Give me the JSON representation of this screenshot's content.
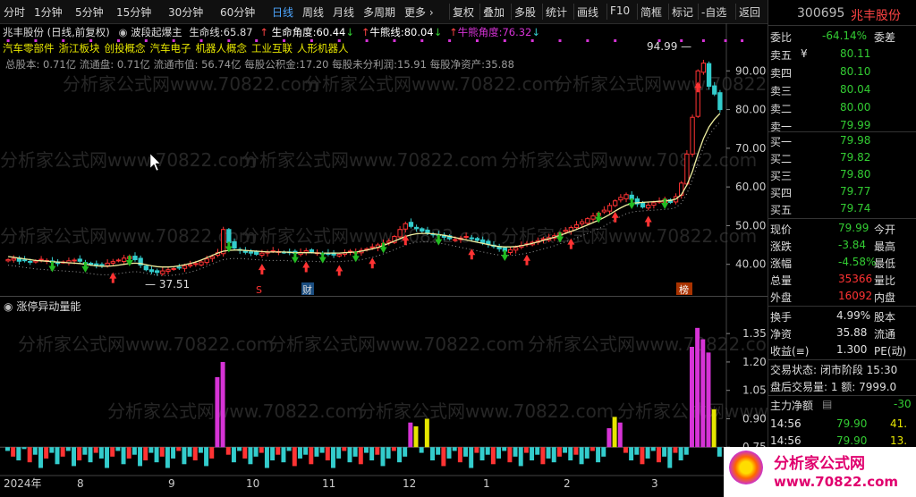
{
  "toolbar": {
    "periods": [
      "分时",
      "1分钟",
      "5分钟",
      "15分钟",
      "30分钟",
      "60分钟",
      "日线",
      "周线",
      "月线",
      "多周期",
      "更多 ›"
    ],
    "active_period": "日线",
    "tools": [
      "复权",
      "叠加",
      "多股",
      "统计",
      "画线",
      "F10",
      "简框",
      "标记",
      "-自选",
      "返回"
    ]
  },
  "info": {
    "title": "兆丰股份 (日线,前复权)",
    "indicator_name": "波段起爆主",
    "life_line_label": "生命线:",
    "life_line_value": "65.87",
    "life_angle_label": "生命角度:",
    "life_angle_value": "60.44",
    "bull_line_label": "牛熊线:",
    "bull_line_value": "80.04",
    "bull_angle_label": "牛熊角度:",
    "bull_angle_value": "76.32",
    "concepts": [
      "汽车零部件",
      "浙江板块",
      "创投概念",
      "汽车电子",
      "机器人概念",
      "工业互联",
      "人形机器人"
    ],
    "fundamentals": "总股本: 0.71亿  流通盘: 0.71亿  流通市值: 56.74亿  每股公积金:17.20  每股未分利润:15.91  每股净资产:35.88"
  },
  "watermark": "分析家公式网www.70822.com",
  "price_labels": {
    "high": "94.99",
    "low": "37.51"
  },
  "chart_markers": {
    "s": "S",
    "cai": "财",
    "bang": "榜"
  },
  "chart_data": [
    {
      "type": "candlestick",
      "y_ticks": [
        "90.00",
        "80.00",
        "70.00",
        "60.00",
        "50.00",
        "40.00"
      ],
      "ylim": [
        33,
        100
      ],
      "x_ticks": [
        "2024年",
        "8",
        "9",
        "10",
        "11",
        "12",
        "1",
        "2",
        "3"
      ],
      "close": [
        41.2,
        41.5,
        40.8,
        41.0,
        40.6,
        40.9,
        41.3,
        41.0,
        40.5,
        40.2,
        40.6,
        40.9,
        41.1,
        40.8,
        40.4,
        40.0,
        39.6,
        39.9,
        40.3,
        40.7,
        41.1,
        41.6,
        42.0,
        41.2,
        39.8,
        38.6,
        38.1,
        37.9,
        38.3,
        38.6,
        38.9,
        39.2,
        39.6,
        39.9,
        40.2,
        40.6,
        41.4,
        42.0,
        43.0,
        49.0,
        45.6,
        44.2,
        43.6,
        43.1,
        42.9,
        42.6,
        42.9,
        43.2,
        43.5,
        43.3,
        43.1,
        43.0,
        42.8,
        43.1,
        43.5,
        43.2,
        43.0,
        42.8,
        42.6,
        42.4,
        42.6,
        43.0,
        43.4,
        43.1,
        43.6,
        44.0,
        44.5,
        45.0,
        45.4,
        46.0,
        47.2,
        49.0,
        50.5,
        49.8,
        49.2,
        48.6,
        48.2,
        47.8,
        47.4,
        47.0,
        46.6,
        46.4,
        46.8,
        47.2,
        46.8,
        46.2,
        45.6,
        45.2,
        44.6,
        44.0,
        43.4,
        43.8,
        44.3,
        44.9,
        45.3,
        45.7,
        46.1,
        46.6,
        46.9,
        47.4,
        48.1,
        48.8,
        49.5,
        50.2,
        51.0,
        51.8,
        52.5,
        53.2,
        54.0,
        55.2,
        56.4,
        57.3,
        58.0,
        56.8,
        55.6,
        54.8,
        55.3,
        55.9,
        56.3,
        56.8,
        56.0,
        57.5,
        61.0,
        68.5,
        78.0,
        90.0,
        92.0,
        86.0,
        84.0,
        79.99
      ],
      "life_line": [
        42.0,
        41.8,
        41.6,
        41.4,
        41.2,
        41.0,
        40.9,
        40.8,
        40.7,
        40.6,
        40.5,
        40.4,
        40.3,
        40.2,
        40.0,
        39.8,
        39.6,
        39.5,
        39.5,
        39.6,
        39.8,
        40.0,
        40.2,
        40.3,
        40.2,
        39.9,
        39.6,
        39.4,
        39.3,
        39.3,
        39.4,
        39.6,
        39.9,
        40.2,
        40.6,
        41.1,
        41.7,
        42.3,
        42.9,
        43.4,
        43.6,
        43.7,
        43.7,
        43.6,
        43.5,
        43.4,
        43.3,
        43.2,
        43.2,
        43.2,
        43.2,
        43.1,
        43.0,
        43.0,
        43.0,
        43.0,
        42.9,
        42.9,
        42.9,
        42.9,
        42.9,
        43.0,
        43.1,
        43.2,
        43.4,
        43.7,
        44.0,
        44.4,
        44.9,
        45.4,
        46.0,
        46.6,
        47.2,
        47.6,
        47.9,
        48.0,
        48.0,
        47.9,
        47.7,
        47.5,
        47.2,
        46.9,
        46.6,
        46.3,
        46.0,
        45.7,
        45.4,
        45.1,
        44.8,
        44.6,
        44.5,
        44.5,
        44.6,
        44.8,
        45.1,
        45.4,
        45.8,
        46.2,
        46.6,
        47.0,
        47.5,
        48.0,
        48.5,
        49.0,
        49.6,
        50.2,
        50.8,
        51.4,
        52.1,
        52.9,
        53.8,
        54.6,
        55.3,
        55.7,
        55.9,
        56.0,
        56.1,
        56.2,
        56.3,
        56.4,
        56.5,
        56.9,
        58.0,
        60.5,
        64.0,
        68.5,
        72.5,
        75.5,
        77.5,
        79.0
      ]
    },
    {
      "type": "bar",
      "title": "涨停异动量能",
      "y_ticks": [
        "1.35",
        "1.20",
        "1.05",
        "0.90",
        "0.75"
      ],
      "ylim": [
        0.6,
        1.45
      ],
      "values": [
        0.73,
        0.7,
        0.68,
        0.74,
        0.67,
        0.71,
        0.64,
        0.69,
        0.72,
        0.66,
        0.7,
        0.73,
        0.65,
        0.68,
        0.71,
        0.67,
        0.72,
        0.69,
        0.64,
        0.7,
        0.73,
        0.66,
        0.69,
        0.71,
        0.65,
        0.68,
        0.72,
        0.67,
        0.7,
        0.64,
        0.69,
        0.73,
        0.66,
        0.7,
        0.68,
        0.72,
        0.65,
        0.69,
        1.12,
        1.2,
        0.71,
        0.67,
        0.73,
        0.69,
        0.66,
        0.7,
        0.72,
        0.64,
        0.68,
        0.71,
        0.67,
        0.73,
        0.65,
        0.69,
        0.71,
        0.66,
        0.7,
        0.72,
        0.68,
        0.64,
        0.69,
        0.73,
        0.67,
        0.7,
        0.66,
        0.72,
        0.68,
        0.71,
        0.65,
        0.69,
        0.73,
        0.67,
        0.7,
        0.88,
        0.86,
        0.72,
        0.9,
        0.68,
        0.71,
        0.65,
        0.69,
        0.73,
        0.67,
        0.7,
        0.64,
        0.72,
        0.68,
        0.71,
        0.66,
        0.69,
        0.73,
        0.67,
        0.7,
        0.65,
        0.72,
        0.68,
        0.71,
        0.66,
        0.69,
        0.67,
        0.7,
        0.72,
        0.68,
        0.71,
        0.66,
        0.69,
        0.73,
        0.67,
        0.7,
        0.85,
        0.91,
        0.88,
        0.72,
        0.68,
        0.71,
        0.66,
        0.69,
        0.73,
        0.67,
        0.7,
        0.64,
        0.72,
        0.68,
        0.71,
        1.28,
        1.38,
        1.32,
        1.25,
        0.95,
        0.7
      ]
    }
  ],
  "quote": {
    "code": "300695",
    "name": "兆丰股份",
    "webi_label": "委比",
    "webi_value": "-64.14%",
    "weicha_label": "委差",
    "sell": [
      {
        "label": "卖五",
        "mark": "¥",
        "price": "80.11"
      },
      {
        "label": "卖四",
        "mark": "",
        "price": "80.10"
      },
      {
        "label": "卖三",
        "mark": "",
        "price": "80.04"
      },
      {
        "label": "卖二",
        "mark": "",
        "price": "80.00"
      },
      {
        "label": "卖一",
        "mark": "",
        "price": "79.99"
      }
    ],
    "buy": [
      {
        "label": "买一",
        "price": "79.98"
      },
      {
        "label": "买二",
        "price": "79.82"
      },
      {
        "label": "买三",
        "price": "79.80"
      },
      {
        "label": "买四",
        "price": "79.77"
      },
      {
        "label": "买五",
        "price": "79.74"
      }
    ],
    "stats": [
      {
        "label": "现价",
        "value": "79.99",
        "tail": "今开",
        "color": "g"
      },
      {
        "label": "涨跌",
        "value": "-3.84",
        "tail": "最高",
        "color": "g"
      },
      {
        "label": "涨幅",
        "value": "-4.58%",
        "tail": "最低",
        "color": "g"
      },
      {
        "label": "总量",
        "value": "35366",
        "tail": "量比",
        "color": "r"
      },
      {
        "label": "外盘",
        "value": "16092",
        "tail": "内盘",
        "color": "r"
      }
    ],
    "stats2": [
      {
        "label": "换手",
        "value": "4.99%",
        "tail": "股本"
      },
      {
        "label": "净资",
        "value": "35.88",
        "tail": "流通"
      },
      {
        "label": "收益(≡)",
        "value": "1.300",
        "tail": "PE(动)"
      }
    ],
    "trade_status": "交易状态: 闭市阶段 15:30",
    "after_hours": "盘后交易量: 1  额: 7999.0",
    "main_net_label": "主力净额",
    "main_net_value": "-30",
    "ticks": [
      {
        "time": "14:56",
        "price": "79.90",
        "vol": "41."
      },
      {
        "time": "14:56",
        "price": "79.90",
        "vol": "13."
      }
    ]
  },
  "logo": {
    "title": "分析家公式网",
    "url": "www.70822.com"
  },
  "colors": {
    "up": "#ff3333",
    "down": "#33cccc",
    "green": "#22bb22",
    "yellow": "#e6e600",
    "magenta": "#d633d6",
    "life": "#f0f0a0"
  }
}
